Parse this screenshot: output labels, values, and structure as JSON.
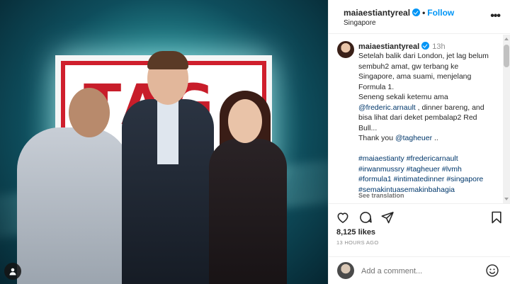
{
  "post": {
    "username": "maiaestiantyreal",
    "follow_label": "Follow",
    "location": "Singapore",
    "more_label": "•••",
    "time_ago": "13h",
    "photo_sign_text": "TAG",
    "caption_lines": [
      "Setelah balik dari London, jet lag belum",
      "sembuh2 amat, gw terbang ke",
      "Singapore, ama suami, menjelang",
      "Formula 1.",
      "Seneng sekali ketemu ama"
    ],
    "mention_frederic": "@frederic.arnault",
    "caption_after_mention": " , dinner bareng, and",
    "caption_lines_2": [
      "bisa lihat dari deket pembalap2 Red",
      "Bull..."
    ],
    "thanks_prefix": "Thank you ",
    "mention_tagheuer": "@tagheuer",
    "thanks_suffix": " ..",
    "hashtag_lines": [
      "#maiaestianty #fredericarnault",
      "#irwanmussry #tagheuer #lvmh",
      "#formula1 #intimatedinner #singapore",
      "#semakintuasemakinbahagia"
    ],
    "see_translation": "See translation",
    "likes": "8,125 likes",
    "posted_ago": "13 HOURS AGO",
    "comment_placeholder": "Add a comment..."
  },
  "colors": {
    "accent": "#0095f6",
    "link": "#00376b",
    "muted": "#8e8e8e",
    "brand_red": "#c81d2a"
  },
  "icons": [
    "verified-badge-icon",
    "more-options-icon",
    "heart-icon",
    "comment-icon",
    "share-icon",
    "bookmark-icon",
    "emoji-icon",
    "user-tag-icon"
  ]
}
